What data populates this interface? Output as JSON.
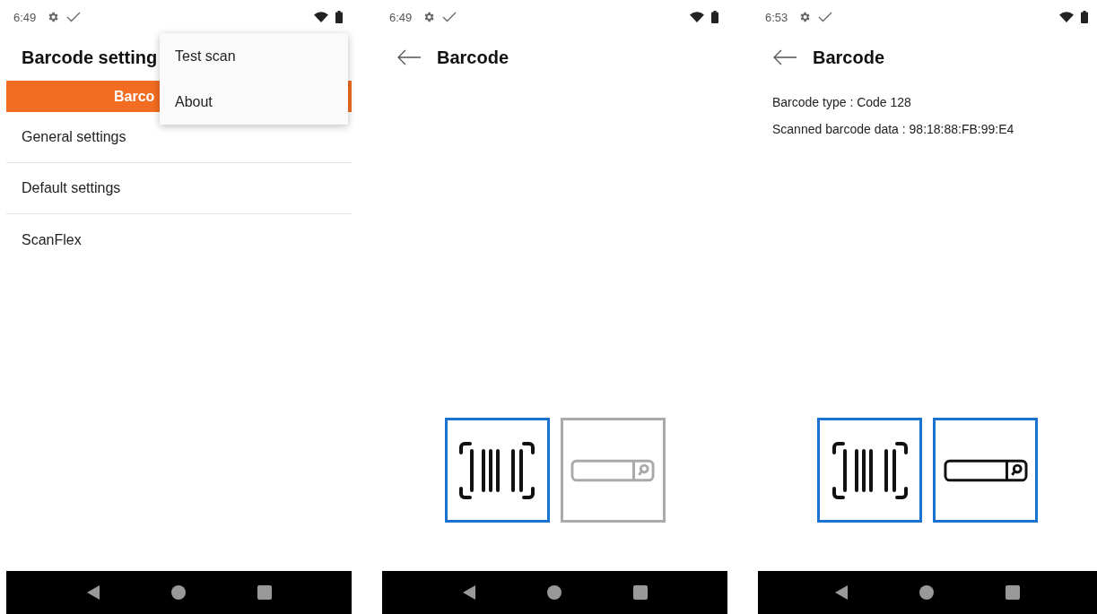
{
  "screens": [
    {
      "kind": "settings",
      "status_bar": {
        "time": "6:49"
      },
      "title": "Barcode setting",
      "tab": {
        "label": "Barco",
        "selected": true
      },
      "items": [
        {
          "label": "General settings"
        },
        {
          "label": "Default settings"
        },
        {
          "label": "ScanFlex"
        }
      ],
      "menu": {
        "items": [
          {
            "label": "Test scan"
          },
          {
            "label": "About"
          }
        ]
      }
    },
    {
      "kind": "scan",
      "status_bar": {
        "time": "6:49"
      },
      "title": "Barcode",
      "modes": [
        {
          "kind": "barcode",
          "enabled": true
        },
        {
          "kind": "search",
          "enabled": false
        }
      ]
    },
    {
      "kind": "scan",
      "status_bar": {
        "time": "6:53"
      },
      "title": "Barcode",
      "info": [
        "Barcode type : Code 128",
        "Scanned barcode data : 98:18:88:FB:99:E4"
      ],
      "modes": [
        {
          "kind": "barcode",
          "enabled": true
        },
        {
          "kind": "search",
          "enabled": true
        }
      ]
    }
  ]
}
